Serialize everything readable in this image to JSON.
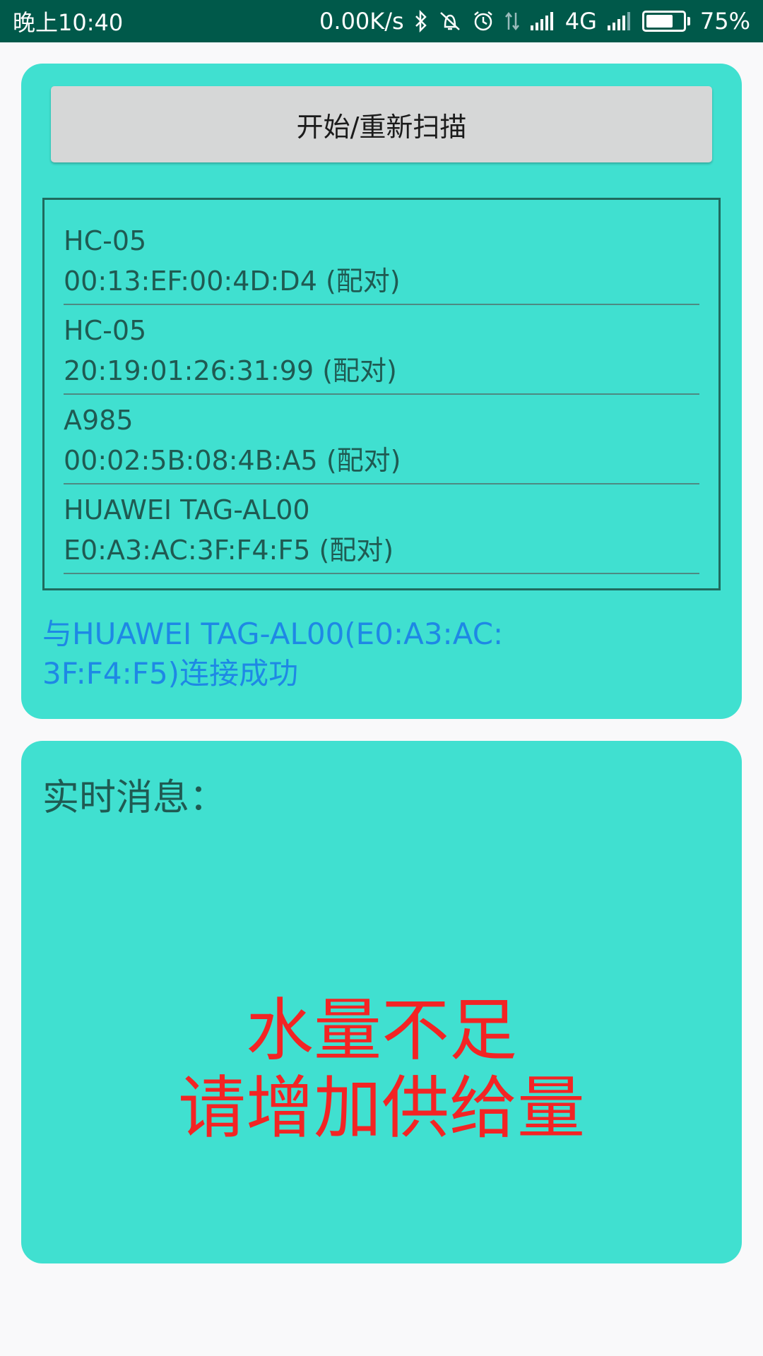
{
  "status_bar": {
    "time": "晚上10:40",
    "network_speed": "0.00K/s",
    "icons": [
      "bluetooth-icon",
      "vibrate-off-icon",
      "alarm-icon",
      "data-transfer-icon",
      "signal-icon",
      "signal-icon"
    ],
    "network_type": "4G",
    "battery_percent": "75%",
    "battery_level": 0.75
  },
  "scan": {
    "button_label": "开始/重新扫描"
  },
  "devices": [
    {
      "name": "HC-05",
      "address": "00:13:EF:00:4D:D4 (配对)"
    },
    {
      "name": "HC-05",
      "address": "20:19:01:26:31:99 (配对)"
    },
    {
      "name": "A985",
      "address": "00:02:5B:08:4B:A5 (配对)"
    },
    {
      "name": "HUAWEI TAG-AL00",
      "address": "E0:A3:AC:3F:F4:F5 (配对)"
    }
  ],
  "connection": {
    "line1": "与HUAWEI TAG-AL00(E0:A3:AC:",
    "line2": "3F:F4:F5)连接成功"
  },
  "realtime": {
    "title": "实时消息：",
    "alert_line1": "水量不足",
    "alert_line2": "请增加供给量"
  },
  "colors": {
    "status_bar": "#00594a",
    "card": "#40e0d0",
    "connection_text": "#1e88e5",
    "alert_text": "#f32424"
  }
}
